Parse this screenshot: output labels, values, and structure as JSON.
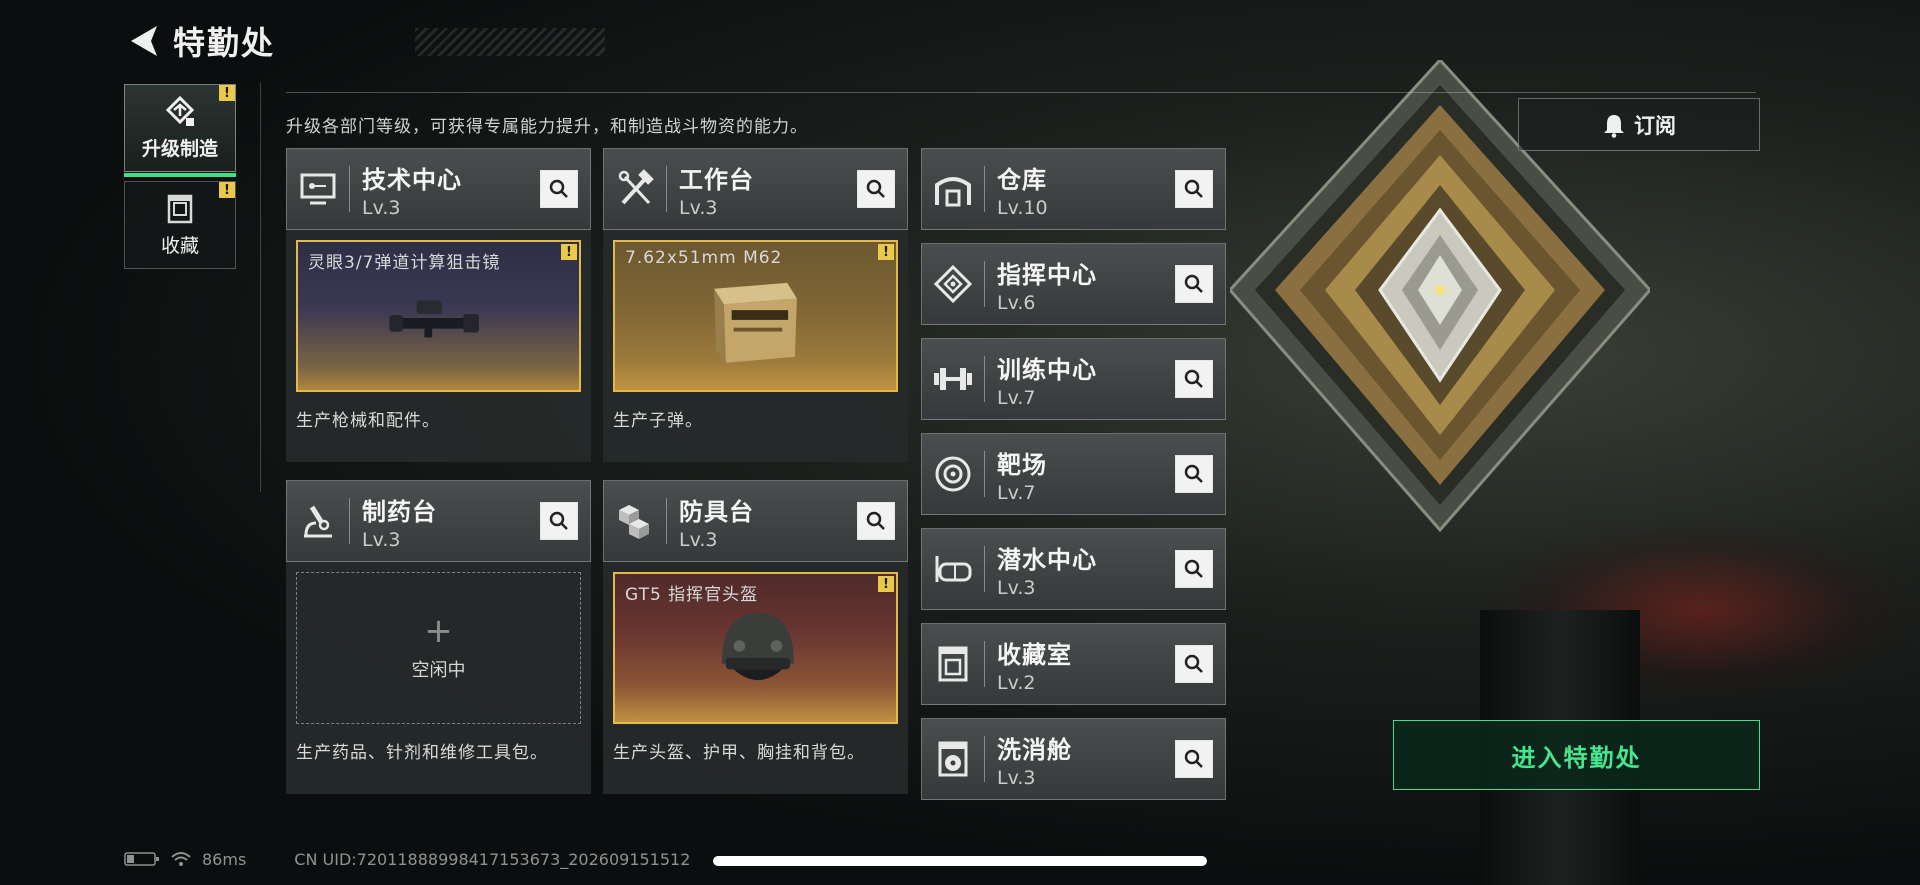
{
  "header": {
    "title": "特勤处"
  },
  "sidebar": {
    "tabs": [
      {
        "label": "升级制造",
        "active": true,
        "badge": "!"
      },
      {
        "label": "收藏",
        "active": false,
        "badge": "!"
      }
    ]
  },
  "description": "升级各部门等级，可获得专属能力提升，和制造战斗物资的能力。",
  "stations": [
    {
      "name": "技术中心",
      "level": "Lv.3",
      "product": "灵眼3/7弹道计算狙击镜",
      "badge": "!",
      "desc": "生产枪械和配件。"
    },
    {
      "name": "工作台",
      "level": "Lv.3",
      "product": "7.62x51mm M62",
      "badge": "!",
      "desc": "生产子弹。"
    },
    {
      "name": "制药台",
      "level": "Lv.3",
      "idle_label": "空闲中",
      "desc": "生产药品、针剂和维修工具包。"
    },
    {
      "name": "防具台",
      "level": "Lv.3",
      "product": "GT5 指挥官头盔",
      "badge": "!",
      "desc": "生产头盔、护甲、胸挂和背包。"
    }
  ],
  "rooms": [
    {
      "name": "仓库",
      "level": "Lv.10",
      "icon": "warehouse-icon"
    },
    {
      "name": "指挥中心",
      "level": "Lv.6",
      "icon": "command-icon"
    },
    {
      "name": "训练中心",
      "level": "Lv.7",
      "icon": "dumbbell-icon"
    },
    {
      "name": "靶场",
      "level": "Lv.7",
      "icon": "target-icon"
    },
    {
      "name": "潜水中心",
      "level": "Lv.3",
      "icon": "diving-mask-icon"
    },
    {
      "name": "收藏室",
      "level": "Lv.2",
      "icon": "collection-icon"
    },
    {
      "name": "洗消舱",
      "level": "Lv.3",
      "icon": "radiation-icon"
    }
  ],
  "subscribe_label": "订阅",
  "enter_label": "进入特勤处",
  "status": {
    "ping": "86ms",
    "uid": "CN UID:7201188899841715367​3_202609151512"
  },
  "colors": {
    "accent_green": "#3fe08a",
    "warn_yellow": "#e9c84a",
    "product_border": "#e5b84a"
  }
}
